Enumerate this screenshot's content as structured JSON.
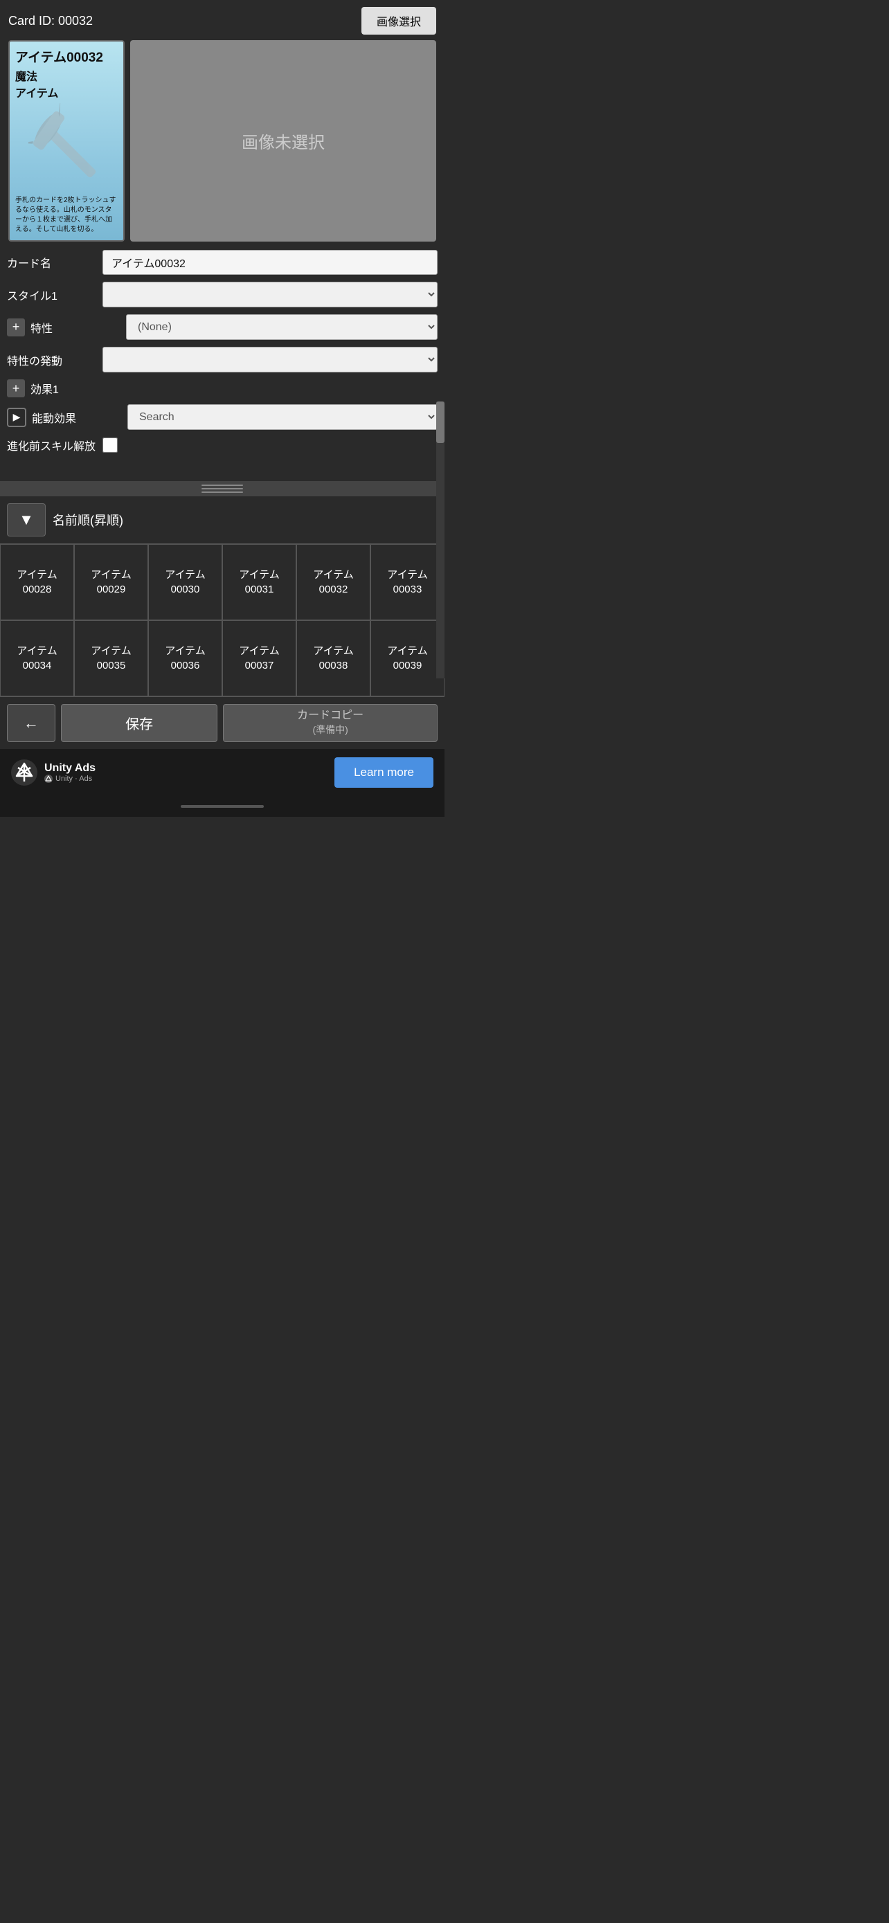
{
  "card": {
    "id_label": "Card ID: 00032",
    "image_select_btn": "画像選択",
    "title": "アイテム00032",
    "type1": "魔法",
    "type2": "アイテム",
    "description": "手札のカードを2枚トラッシュするなら使える。山札のモンスターから１枚まで選び、手札へ加える。そして山札を切る。",
    "no_image_text": "画像未選択"
  },
  "form": {
    "card_name_label": "カード名",
    "card_name_value": "アイテム00032",
    "style1_label": "スタイル1",
    "style1_value": "",
    "trait_label": "特性",
    "trait_value": "(None)",
    "trait_trigger_label": "特性の発動",
    "trait_trigger_value": "",
    "effect1_label": "効果1",
    "active_effect_label": "能動効果",
    "active_effect_placeholder": "Search",
    "pre_evo_label": "進化前スキル解放"
  },
  "sort": {
    "sort_btn_arrow": "▼",
    "sort_label": "名前順(昇順)"
  },
  "grid": {
    "items": [
      {
        "line1": "アイテム",
        "line2": "00028"
      },
      {
        "line1": "アイテム",
        "line2": "00029"
      },
      {
        "line1": "アイテム",
        "line2": "00030"
      },
      {
        "line1": "アイテム",
        "line2": "00031"
      },
      {
        "line1": "アイテム",
        "line2": "00032"
      },
      {
        "line1": "アイテム",
        "line2": "00033"
      },
      {
        "line1": "アイテム",
        "line2": "00034"
      },
      {
        "line1": "アイテム",
        "line2": "00035"
      },
      {
        "line1": "アイテム",
        "line2": "00036"
      },
      {
        "line1": "アイテム",
        "line2": "00037"
      },
      {
        "line1": "アイテム",
        "line2": "00038"
      },
      {
        "line1": "アイテム",
        "line2": "00039"
      }
    ]
  },
  "buttons": {
    "back": "←",
    "save": "保存",
    "copy": "カードコピー\n(準備中)"
  },
  "ad": {
    "brand": "Unity Ads",
    "sub": "Unity · Ads",
    "learn_more": "Learn more"
  }
}
